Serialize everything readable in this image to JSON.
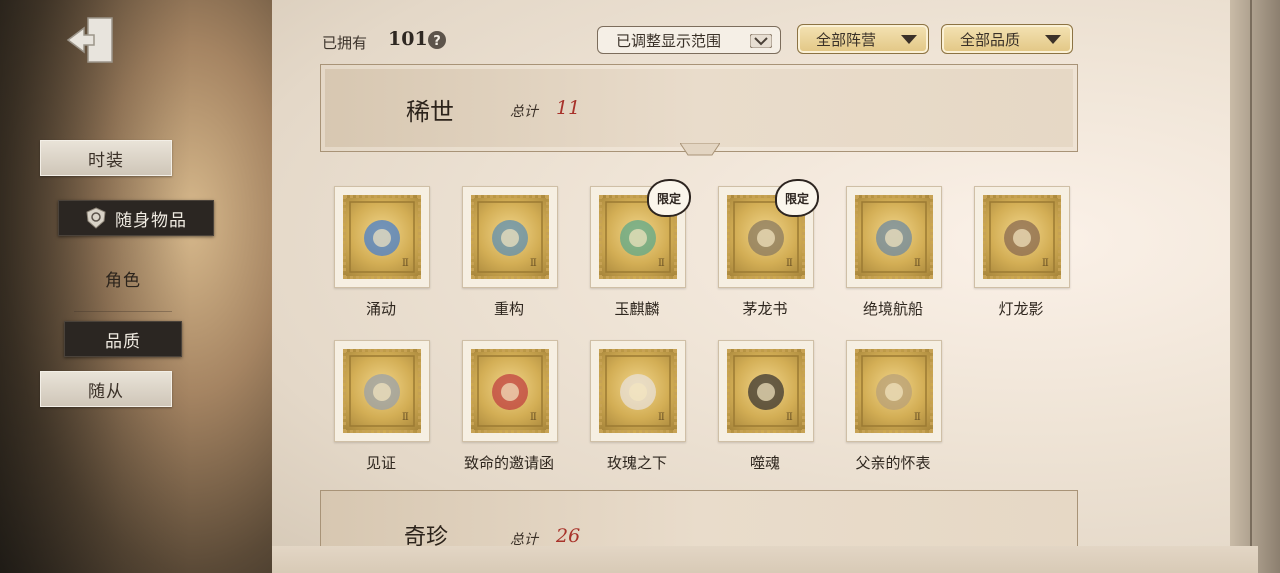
{
  "sidebar": {
    "items": [
      {
        "label": "时装",
        "style": "light"
      },
      {
        "label": "随身物品",
        "style": "dark"
      },
      {
        "label": "角色",
        "style": "plain"
      },
      {
        "label": "品质",
        "style": "dark"
      },
      {
        "label": "随从",
        "style": "light"
      }
    ]
  },
  "header": {
    "owned_label": "已拥有",
    "owned_count": "101",
    "filters": [
      {
        "label": "已调整显示范围"
      },
      {
        "label": "全部阵营"
      },
      {
        "label": "全部品质"
      }
    ]
  },
  "sections": [
    {
      "title": "稀世",
      "total_label": "总计",
      "total": "11"
    },
    {
      "title": "奇珍",
      "total_label": "总计",
      "total": "26"
    }
  ],
  "items": [
    {
      "name": "涌动",
      "limited": false,
      "tag": ""
    },
    {
      "name": "重构",
      "limited": false,
      "tag": ""
    },
    {
      "name": "玉麒麟",
      "limited": true,
      "tag": "限定"
    },
    {
      "name": "茅龙书",
      "limited": true,
      "tag": "限定"
    },
    {
      "name": "绝境航船",
      "limited": false,
      "tag": ""
    },
    {
      "name": "灯龙影",
      "limited": false,
      "tag": ""
    },
    {
      "name": "见证",
      "limited": false,
      "tag": ""
    },
    {
      "name": "致命的邀请函",
      "limited": false,
      "tag": ""
    },
    {
      "name": "玫瑰之下",
      "limited": false,
      "tag": ""
    },
    {
      "name": "噬魂",
      "limited": false,
      "tag": ""
    },
    {
      "name": "父亲的怀表",
      "limited": false,
      "tag": ""
    }
  ],
  "colors": {
    "accent_red": "#a8322a",
    "gold": "#d3ae55",
    "dark_tab": "#2b2622"
  }
}
